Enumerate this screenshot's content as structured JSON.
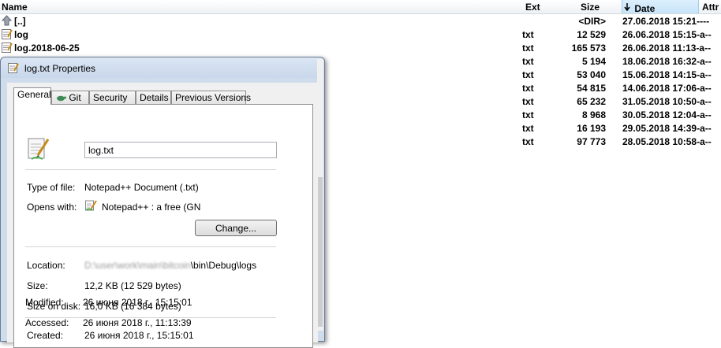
{
  "list": {
    "headers": {
      "name": "Name",
      "ext": "Ext",
      "size": "Size",
      "date": "Date",
      "attr": "Attr",
      "sort_indicator": "sort-down-arrow"
    },
    "rows": [
      {
        "name": "[..]",
        "ext": "",
        "size": "<DIR>",
        "date": "27.06.2018 15:21----",
        "icon": "up-folder-icon"
      },
      {
        "name": "log",
        "ext": "txt",
        "size": "12 529",
        "date": "26.06.2018 15:15-a--",
        "icon": "text-file-icon"
      },
      {
        "name": "log.2018-06-25",
        "ext": "txt",
        "size": "165 573",
        "date": "26.06.2018 11:13-a--",
        "icon": "text-file-icon"
      },
      {
        "name": "",
        "ext": "txt",
        "size": "5 194",
        "date": "18.06.2018 16:32-a--"
      },
      {
        "name": "",
        "ext": "txt",
        "size": "53 040",
        "date": "15.06.2018 14:15-a--"
      },
      {
        "name": "",
        "ext": "txt",
        "size": "54 815",
        "date": "14.06.2018 17:06-a--"
      },
      {
        "name": "",
        "ext": "txt",
        "size": "65 232",
        "date": "31.05.2018 10:50-a--"
      },
      {
        "name": "",
        "ext": "txt",
        "size": "8 968",
        "date": "30.05.2018 12:04-a--"
      },
      {
        "name": "",
        "ext": "txt",
        "size": "16 193",
        "date": "29.05.2018 14:39-a--"
      },
      {
        "name": "",
        "ext": "txt",
        "size": "97 773",
        "date": "28.05.2018 10:58-a--"
      }
    ]
  },
  "dialog": {
    "title": "log.txt Properties",
    "tabs": [
      "General",
      "Git",
      "Security",
      "Details",
      "Previous Versions"
    ],
    "active_tab": "General",
    "filename": "log.txt",
    "type_label": "Type of file:",
    "type_value": "Notepad++ Document (.txt)",
    "opens_label": "Opens with:",
    "opens_value": "Notepad++ : a free (GN",
    "change_button": "Change...",
    "location_label": "Location:",
    "location_blurred": "D:\\user\\work\\main\\bitcoin",
    "location_suffix": "\\bin\\Debug\\logs",
    "size_label": "Size:",
    "size_value": "12,2 KB (12 529 bytes)",
    "size_on_disk_label": "Size on disk:",
    "size_on_disk_value": "16,0 KB (16 384 bytes)",
    "created_label": "Created:",
    "created_value": "26 июня 2018 г., 15:15:01",
    "modified_label": "Modified:",
    "modified_value": "26 июня 2018 г., 15:15:01",
    "accessed_label": "Accessed:",
    "accessed_value": "26 июня 2018 г., 11:13:39"
  },
  "colors": {
    "accent_header": "#c6e4f8",
    "dialog_frame": "#cfdcec"
  }
}
